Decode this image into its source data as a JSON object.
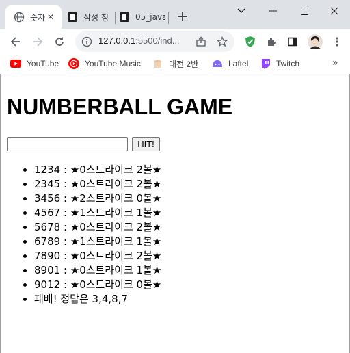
{
  "browser": {
    "tabs": [
      {
        "title": "숫자",
        "favicon": "globe-icon",
        "active": true
      },
      {
        "title": "삼성 청",
        "favicon": "page-icon",
        "active": false
      },
      {
        "title": "05_java",
        "favicon": "page-icon",
        "active": false
      }
    ],
    "new_tab_label": "+",
    "address": {
      "host": "127.0.0.1",
      "rest": ":5500/ind..."
    },
    "bookmarks": [
      {
        "label": "YouTube",
        "icon": "youtube-icon",
        "color": "#ff0000"
      },
      {
        "label": "YouTube Music",
        "icon": "youtube-music-icon",
        "color": "#ff0000"
      },
      {
        "label": "대전 2반",
        "icon": "folder-icon",
        "color": "#e8c39e"
      },
      {
        "label": "Laftel",
        "icon": "laftel-icon",
        "color": "#816bff"
      },
      {
        "label": "Twitch",
        "icon": "twitch-icon",
        "color": "#9146ff"
      }
    ],
    "bookmarks_more": "»"
  },
  "page": {
    "heading": "NUMBERBALL GAME",
    "input_value": "",
    "hit_label": "HIT!",
    "results": [
      "1234 : ★0스트라이크 2볼★",
      "2345 : ★0스트라이크 2볼★",
      "3456 : ★2스트라이크 0볼★",
      "4567 : ★1스트라이크 1볼★",
      "5678 : ★0스트라이크 2볼★",
      "6789 : ★1스트라이크 1볼★",
      "7890 : ★0스트라이크 2볼★",
      "8901 : ★0스트라이크 1볼★",
      "9012 : ★0스트라이크 0볼★",
      "패배! 정답은 3,4,8,7"
    ]
  }
}
